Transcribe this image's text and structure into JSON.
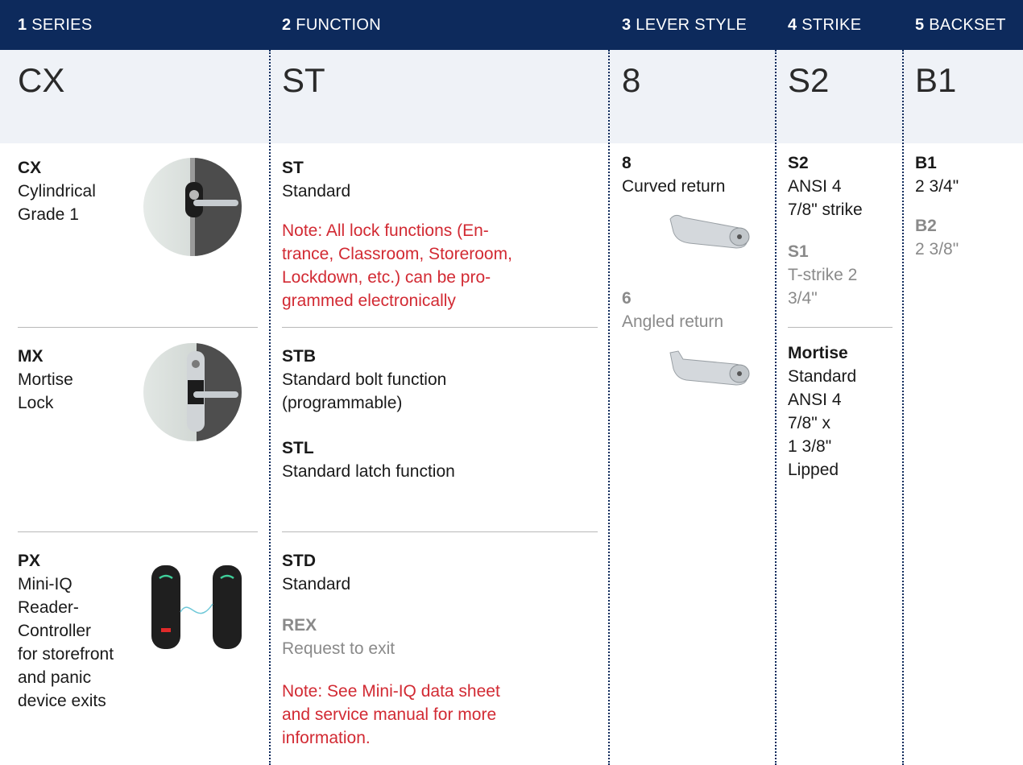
{
  "header": {
    "cols": [
      {
        "num": "1",
        "label": "SERIES"
      },
      {
        "num": "2",
        "label": "FUNCTION"
      },
      {
        "num": "3",
        "label": "LEVER STYLE"
      },
      {
        "num": "4",
        "label": "STRIKE"
      },
      {
        "num": "5",
        "label": "BACKSET"
      }
    ]
  },
  "selected": {
    "series": "CX",
    "function": "ST",
    "lever": "8",
    "strike": "S2",
    "backset": "B1"
  },
  "series": {
    "cx": {
      "code": "CX",
      "desc": [
        "Cylindrical",
        "Grade 1"
      ]
    },
    "mx": {
      "code": "MX",
      "desc": [
        "Mortise",
        "Lock"
      ]
    },
    "px": {
      "code": "PX",
      "desc": [
        "Mini-IQ",
        "Reader-",
        "Controller",
        "for storefront",
        "and panic",
        "device exits"
      ]
    }
  },
  "function": {
    "st": {
      "code": "ST",
      "desc": "Standard",
      "note": [
        "Note: All lock functions (En-",
        "trance, Classroom, Storeroom,",
        "Lockdown, etc.) can be pro-",
        "grammed electronically"
      ]
    },
    "stb": {
      "code": "STB",
      "desc": [
        "Standard bolt function",
        "(programmable)"
      ]
    },
    "stl": {
      "code": "STL",
      "desc": "Standard latch function"
    },
    "std": {
      "code": "STD",
      "desc": "Standard"
    },
    "rex": {
      "code": "REX",
      "desc": "Request to exit"
    },
    "note2": [
      "Note: See Mini-IQ data sheet",
      "and service manual for more",
      "information."
    ]
  },
  "lever": {
    "l8": {
      "code": "8",
      "desc": "Curved return"
    },
    "l6": {
      "code": "6",
      "desc": "Angled return"
    }
  },
  "strike": {
    "s2": {
      "code": "S2",
      "desc": [
        "ANSI 4",
        "7/8\" strike"
      ]
    },
    "s1": {
      "code": "S1",
      "desc": [
        "T-strike 2",
        "3/4\""
      ]
    },
    "mortise": {
      "code": "Mortise",
      "desc": [
        "Standard",
        "ANSI 4",
        "7/8\" x",
        "1 3/8\"",
        "Lipped"
      ]
    }
  },
  "backset": {
    "b1": {
      "code": "B1",
      "desc": "2 3/4\""
    },
    "b2": {
      "code": "B2",
      "desc": "2 3/8\""
    }
  },
  "colors": {
    "header_bg": "#0d2a5c",
    "band_bg": "#eff2f7",
    "note_red": "#d22a33",
    "inactive_gray": "#8a8a8a"
  }
}
